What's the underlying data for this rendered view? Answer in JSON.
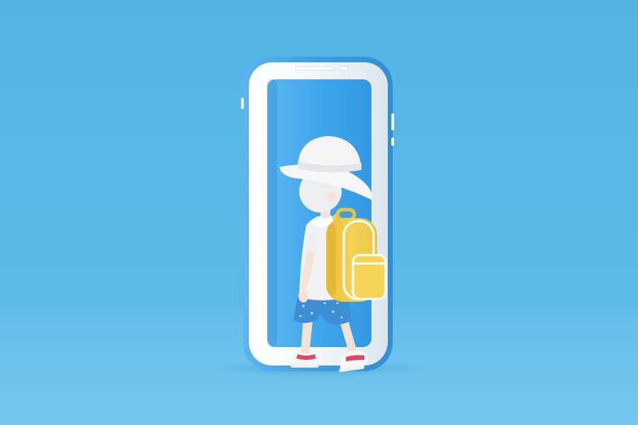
{
  "colors": {
    "background_top": "#52B5E6",
    "background_bottom": "#6CC3EC",
    "phone_frame": "#3B9FE0",
    "phone_bezel": "#F4F6F8",
    "phone_screen": "#3EA6EC",
    "hat": "#F5F5F5",
    "hair": "#ECEEF0",
    "skin": "#F7E3D8",
    "shirt": "#F1F3F4",
    "backpack": "#F2CF4C",
    "backpack_trim": "#FFFFFF",
    "shorts": "#3E8FD6",
    "sneaker_accent": "#E0466B"
  },
  "icons": [
    "smartphone-icon"
  ]
}
